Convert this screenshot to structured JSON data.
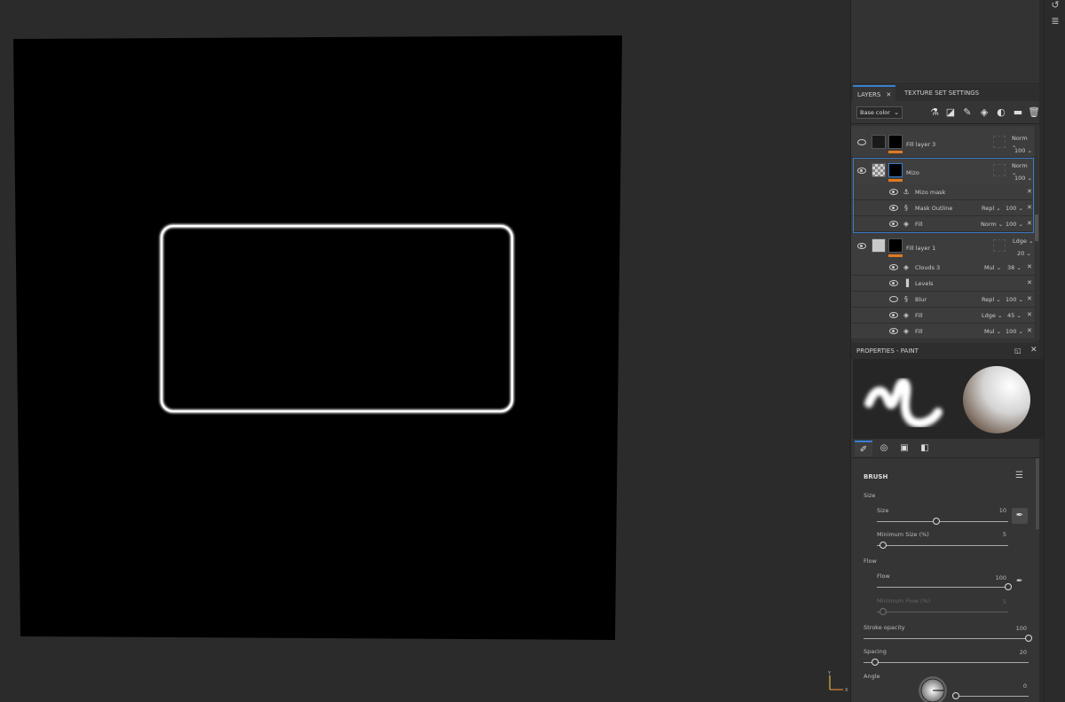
{
  "layers_panel": {
    "tabs": [
      {
        "label": "LAYERS",
        "active": true
      },
      {
        "label": "TEXTURE SET SETTINGS",
        "active": false
      }
    ],
    "channel": "Base color",
    "toolbar_icons": [
      "magic-wand-icon",
      "add-mask-icon",
      "brush-icon",
      "fill-icon",
      "smart-material-icon",
      "folder-icon",
      "trash-icon"
    ],
    "layers": [
      {
        "name": "Fill layer 3",
        "blend": "Norm",
        "opacity": "100",
        "visible": false
      },
      {
        "name": "Mizo",
        "blend": "Norm",
        "opacity": "100",
        "visible": true,
        "selected": true,
        "effects": [
          {
            "name": "Mizo mask",
            "blend": "",
            "opacity": "",
            "icon": "anchor-icon"
          },
          {
            "name": "Mask Outline",
            "blend": "Repl",
            "opacity": "100",
            "icon": "generator-icon"
          },
          {
            "name": "Fill",
            "blend": "Norm",
            "opacity": "100",
            "icon": "fill-icon"
          }
        ]
      },
      {
        "name": "Fill layer 1",
        "blend": "Ldge",
        "opacity": "20",
        "visible": true,
        "effects": [
          {
            "name": "Clouds 3",
            "blend": "Mul",
            "opacity": "38",
            "icon": "fill-icon",
            "visible": true
          },
          {
            "name": "Levels",
            "blend": "",
            "opacity": "",
            "icon": "levels-icon",
            "visible": true
          },
          {
            "name": "Blur",
            "blend": "Repl",
            "opacity": "100",
            "icon": "generator-icon",
            "visible": false
          },
          {
            "name": "Fill",
            "blend": "Ldge",
            "opacity": "45",
            "icon": "fill-icon",
            "visible": true
          },
          {
            "name": "Fill",
            "blend": "Mul",
            "opacity": "100",
            "icon": "fill-icon",
            "visible": true
          }
        ]
      }
    ]
  },
  "properties": {
    "title": "PROPERTIES - PAINT",
    "tab_icons": [
      "brush-tip-icon",
      "alpha-icon",
      "stencil-icon",
      "material-icon"
    ],
    "brush_header": "BRUSH",
    "size_group": "Size",
    "size": {
      "label": "Size",
      "value": "10",
      "fraction": 0.45
    },
    "min_size": {
      "label": "Minimum Size (%)",
      "value": "5",
      "fraction": 0.05
    },
    "flow_group": "Flow",
    "flow": {
      "label": "Flow",
      "value": "100",
      "fraction": 1.0
    },
    "min_flow": {
      "label": "Minimum Flow (%)",
      "value": "5",
      "fraction": 0.05
    },
    "stroke_opacity": {
      "label": "Stroke opacity",
      "value": "100",
      "fraction": 1.0
    },
    "spacing": {
      "label": "Spacing",
      "value": "20",
      "fraction": 0.07
    },
    "angle": {
      "label": "Angle",
      "value": "0",
      "fraction": 0.0
    }
  },
  "gizmo": {
    "x": "X",
    "y": "Y"
  },
  "colors": {
    "accent": "#3a7fd0",
    "panel_bg": "#333333",
    "viewport_bg": "#2b2b2b",
    "mask_orange": "#e07a20",
    "canvas": "#000000",
    "outline": "#ffffff"
  }
}
